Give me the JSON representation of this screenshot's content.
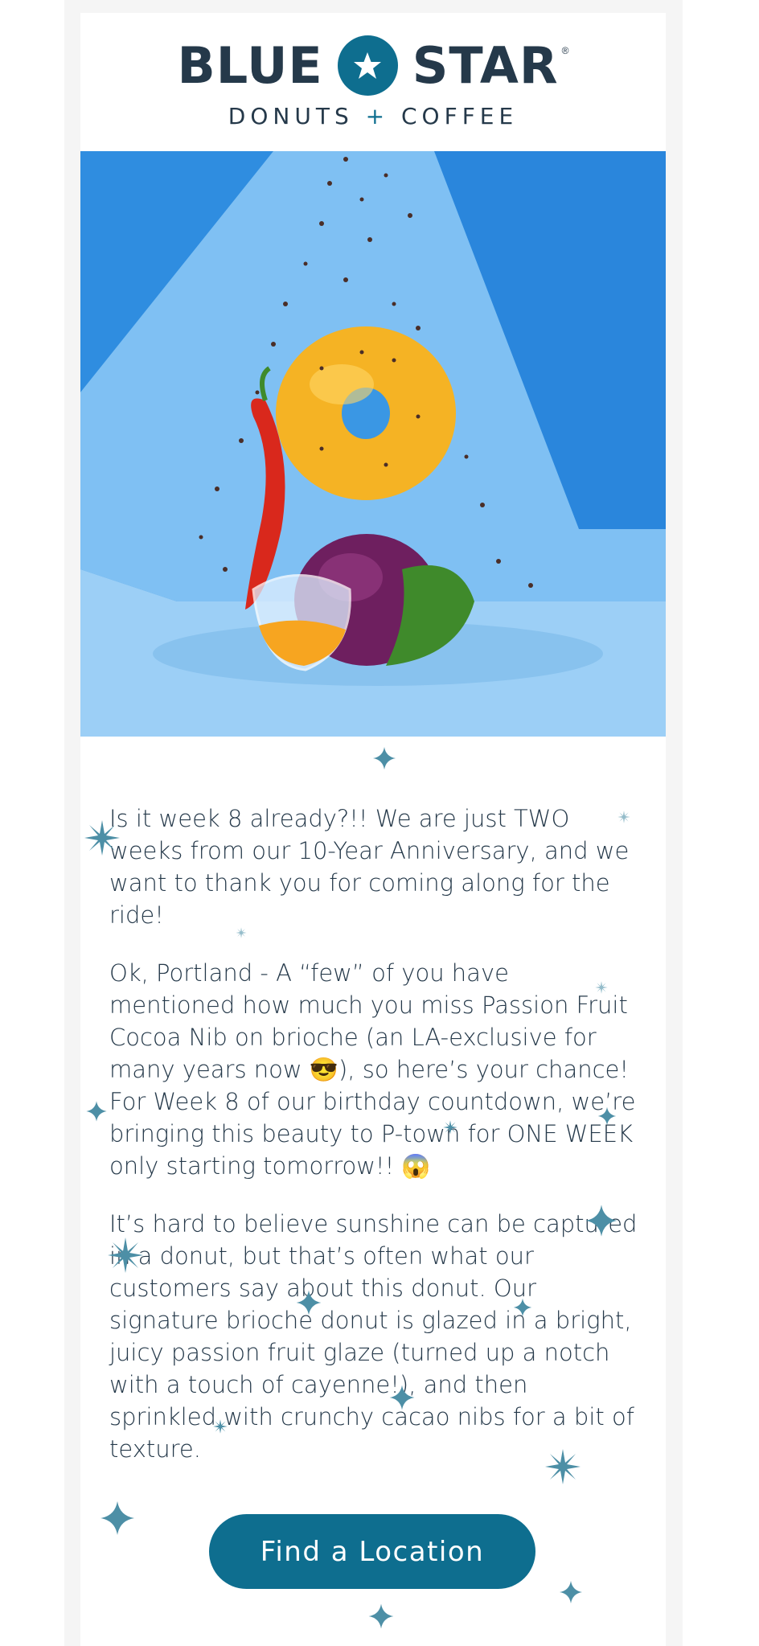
{
  "brand": {
    "word_left": "BLUE",
    "word_right": "STAR",
    "registered": "®",
    "tagline_left": "DONUTS",
    "tagline_plus": "+",
    "tagline_right": "COFFEE",
    "colors": {
      "navy": "#25394a",
      "teal": "#0e6e8f",
      "hero_blue": "#3a97e4"
    }
  },
  "hero": {
    "icon": "donut-chili-passionfruit-photo"
  },
  "content": {
    "paragraphs": [
      "Is it week 8 already?!! We are just TWO weeks from our 10-Year Anniversary, and we want to thank you for coming along for the ride!",
      "Ok, Portland -  A “few” of you have mentioned how much you miss Passion Fruit Cocoa Nib on brioche (an LA-exclusive for many years now 😎), so here’s your chance! For Week 8 of our birthday countdown, we’re bringing this beauty to P-town for ONE WEEK only starting tomorrow!! 😱",
      "It’s hard to believe sunshine can be captured in a donut, but that’s often what our customers say about this donut. Our signature brioche donut is glazed in a bright, juicy passion fruit glaze (turned up a notch with a touch of cayenne!), and then sprinkled with crunchy cacao nibs for a bit of texture."
    ]
  },
  "cta": {
    "label": "Find a Location"
  }
}
